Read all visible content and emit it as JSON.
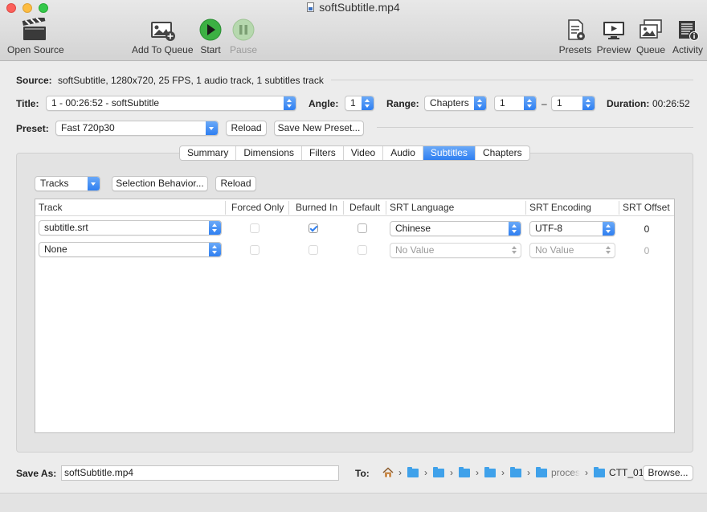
{
  "window": {
    "title": "softSubtitle.mp4"
  },
  "toolbar": {
    "open_source": "Open Source",
    "add_to_queue": "Add To Queue",
    "start": "Start",
    "pause": "Pause",
    "presets": "Presets",
    "preview": "Preview",
    "queue": "Queue",
    "activity": "Activity"
  },
  "source": {
    "label": "Source:",
    "value": "softSubtitle, 1280x720, 25 FPS, 1 audio track, 1 subtitles track"
  },
  "title_row": {
    "title_label": "Title:",
    "title_value": "1 - 00:26:52 - softSubtitle",
    "angle_label": "Angle:",
    "angle_value": "1",
    "range_label": "Range:",
    "range_value": "Chapters",
    "range_start": "1",
    "range_dash": "–",
    "range_end": "1",
    "duration_label": "Duration:",
    "duration_value": "00:26:52"
  },
  "preset_row": {
    "label": "Preset:",
    "value": "Fast 720p30",
    "reload": "Reload",
    "save_new": "Save New Preset..."
  },
  "tabs": [
    "Summary",
    "Dimensions",
    "Filters",
    "Video",
    "Audio",
    "Subtitles",
    "Chapters"
  ],
  "active_tab": "Subtitles",
  "subtitles": {
    "tracks_menu": "Tracks",
    "selection_behavior": "Selection Behavior...",
    "reload": "Reload",
    "columns": [
      "Track",
      "Forced Only",
      "Burned In",
      "Default",
      "SRT Language",
      "SRT Encoding",
      "SRT Offset"
    ],
    "rows": [
      {
        "track": "subtitle.srt",
        "forced": false,
        "burned": true,
        "default": false,
        "language": "Chinese",
        "encoding": "UTF-8",
        "offset": "0",
        "enabled": true
      },
      {
        "track": "None",
        "forced": false,
        "burned": false,
        "default": false,
        "language": "No Value",
        "encoding": "No Value",
        "offset": "0",
        "enabled": false
      }
    ]
  },
  "save": {
    "label": "Save As:",
    "filename": "softSubtitle.mp4",
    "to_label": "To:",
    "path_partial_1": "proces",
    "path_last": "CTT_01",
    "browse": "Browse..."
  },
  "colors": {
    "accent": "#2f7ff1",
    "start_green": "#3cb043"
  }
}
